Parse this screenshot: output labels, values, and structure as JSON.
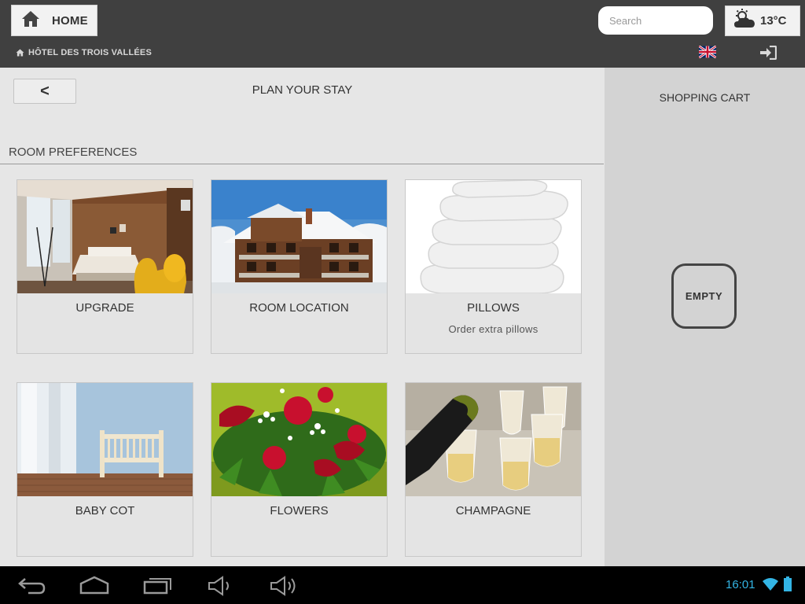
{
  "header": {
    "home_label": "HOME",
    "home_icon": "home-icon",
    "search_placeholder": "Search",
    "weather": {
      "icon": "partly-cloudy-icon",
      "temperature": "13°C"
    },
    "hotel_name": "HÔTEL DES TROIS VALLÉES",
    "language_flag": "uk-flag-icon",
    "login_icon": "sign-in-icon"
  },
  "main": {
    "back_label": "<",
    "page_title": "PLAN YOUR STAY",
    "section_title": "ROOM PREFERENCES",
    "cards": [
      {
        "name": "UPGRADE",
        "description": "",
        "image": "hotel-bedroom"
      },
      {
        "name": "ROOM LOCATION",
        "description": "",
        "image": "chalet-hotel-building"
      },
      {
        "name": "PILLOWS",
        "description": "Order extra pillows",
        "image": "stack-of-pillows"
      },
      {
        "name": "BABY COT",
        "description": "",
        "image": "baby-cot"
      },
      {
        "name": "FLOWERS",
        "description": "",
        "image": "flower-bouquet"
      },
      {
        "name": "CHAMPAGNE",
        "description": "",
        "image": "champagne-glasses"
      }
    ]
  },
  "cart": {
    "title": "SHOPPING CART",
    "status": "EMPTY"
  },
  "system_bar": {
    "time": "16:01",
    "icons": [
      "back-icon",
      "home-icon",
      "recent-apps-icon",
      "volume-down-icon",
      "volume-up-icon",
      "wifi-icon",
      "battery-icon"
    ]
  },
  "colors": {
    "header_bg": "#404040",
    "main_bg": "#e6e6e6",
    "cart_bg": "#d3d3d3",
    "time_accent": "#33b5e5"
  }
}
